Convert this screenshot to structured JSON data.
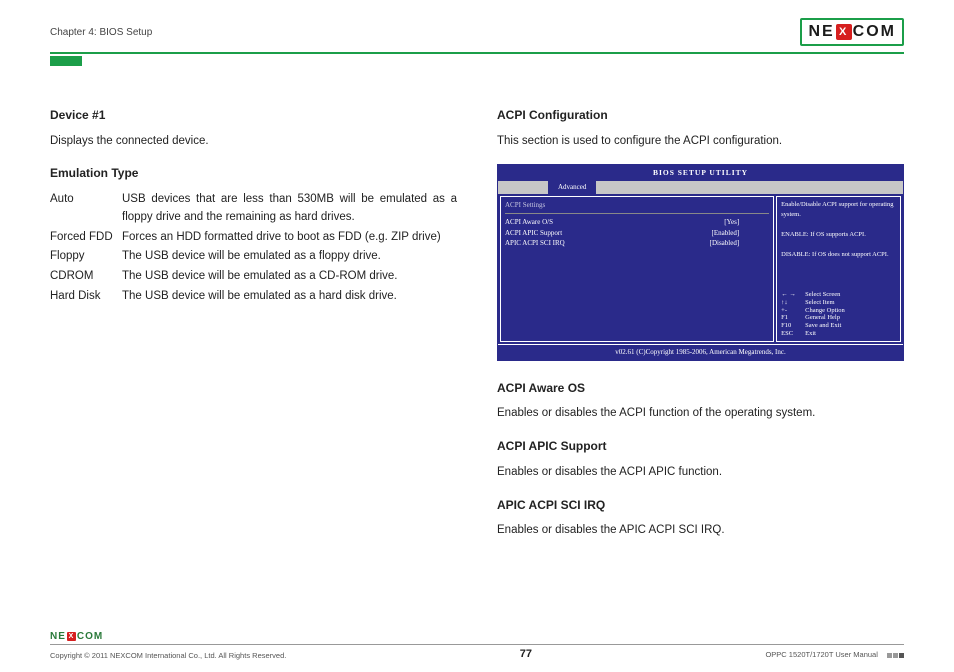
{
  "header": {
    "chapter": "Chapter 4: BIOS Setup",
    "brand_pre": "NE",
    "brand_x": "X",
    "brand_post": "COM"
  },
  "left": {
    "device_h": "Device #1",
    "device_p": "Displays the connected device.",
    "emu_h": "Emulation Type",
    "rows": {
      "auto_t": "Auto",
      "auto_d": "USB devices that are less than 530MB will be emulated as a floppy drive and the remaining as hard drives.",
      "fdd_t": "Forced FDD",
      "fdd_d": "Forces an HDD formatted drive to boot as FDD (e.g. ZIP drive)",
      "floppy_t": "Floppy",
      "floppy_d": "The USB device will be emulated as a floppy drive.",
      "cdrom_t": "CDROM",
      "cdrom_d": "The USB device will be emulated as a CD-ROM drive.",
      "hd_t": "Hard Disk",
      "hd_d": "The USB device will be emulated as a hard disk drive."
    }
  },
  "right": {
    "acpi_conf_h": "ACPI Configuration",
    "acpi_conf_p": "This section is used to configure the ACPI configuration.",
    "aware_h": "ACPI Aware OS",
    "aware_p": "Enables or disables the ACPI function of the operating system.",
    "apic_h": "ACPI APIC Support",
    "apic_p": "Enables or disables the ACPI APIC function.",
    "sci_h": "APIC ACPI SCI IRQ",
    "sci_p": "Enables or disables the APIC ACPI SCI IRQ."
  },
  "bios": {
    "title": "BIOS SETUP UTILITY",
    "tab": "Advanced",
    "section": "ACPI Settings",
    "rows": {
      "r1o": "ACPI Aware O/S",
      "r1v": "[Yes]",
      "r2o": "ACPI APIC Support",
      "r2v": "[Enabled]",
      "r3o": "APIC ACPI SCI IRQ",
      "r3v": "[Disabled]"
    },
    "help1": "Enable/Disable ACPI support for operating system.",
    "help2": "ENABLE: If OS supports ACPI.",
    "help3": "DISABLE: If OS does not support ACPI.",
    "nav": {
      "k1": "← →",
      "v1": "Select Screen",
      "k2": "↑↓",
      "v2": "Select Item",
      "k3": "+-",
      "v3": "Change Option",
      "k4": "F1",
      "v4": "General Help",
      "k5": "F10",
      "v5": "Save and Exit",
      "k6": "ESC",
      "v6": "Exit"
    },
    "footer": "v02.61 (C)Copyright 1985-2006, American Megatrends, Inc."
  },
  "footer": {
    "copyright": "Copyright © 2011 NEXCOM International Co., Ltd. All Rights Reserved.",
    "page": "77",
    "manual": "OPPC 1520T/1720T User Manual"
  }
}
